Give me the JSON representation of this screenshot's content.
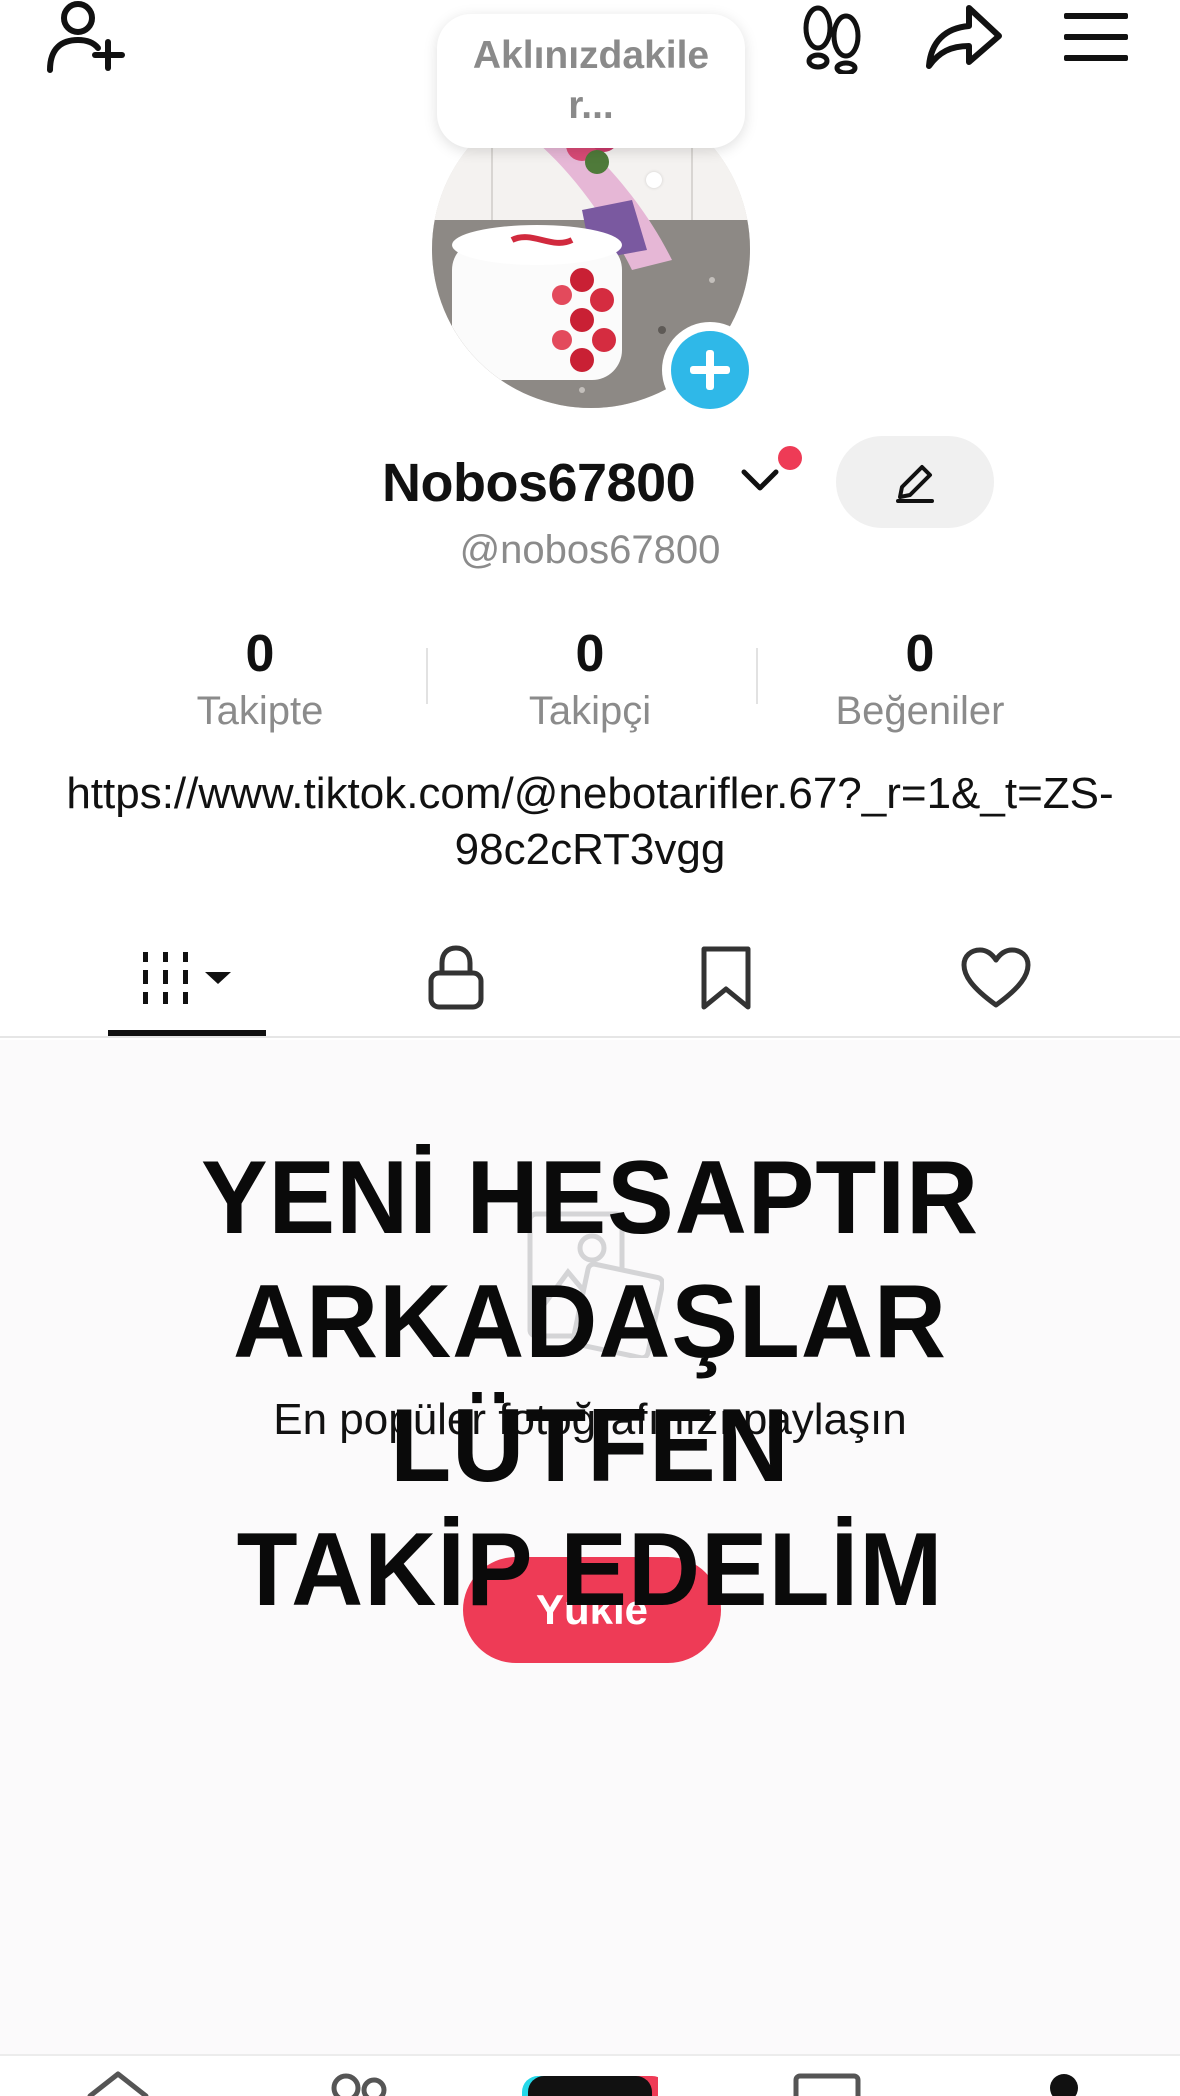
{
  "top_bar": {
    "add_friend_icon": "person-plus-icon",
    "footprint_icon": "footprints-icon",
    "share_icon": "share-arrow-icon",
    "menu_icon": "hamburger-menu-icon"
  },
  "thought_bubble": {
    "text": "Aklınızdakile r..."
  },
  "profile": {
    "display_name": "Nobos67800",
    "handle": "@nobos67800",
    "bio_link": "https://www.tiktok.com/@nebotarifler.67?_r=1&_t=ZS-98c2cRT3vgg"
  },
  "stats": [
    {
      "value": "0",
      "label": "Takipte"
    },
    {
      "value": "0",
      "label": "Takipçi"
    },
    {
      "value": "0",
      "label": "Beğeniler"
    }
  ],
  "tabs": [
    {
      "icon": "grid-filter-icon"
    },
    {
      "icon": "lock-icon"
    },
    {
      "icon": "bookmark-icon"
    },
    {
      "icon": "heart-icon"
    }
  ],
  "empty_state": {
    "text": "En popüler fotoğrafınızı paylaşın",
    "button_label": "Yükle"
  },
  "overlay_text": {
    "line1": "YENİ HESAPTIR",
    "line2": "ARKADAŞLAR LÜTFEN",
    "line3": "TAKİP EDELİM"
  },
  "colors": {
    "accent_red": "#ee3b56",
    "add_blue": "#2fb8e8",
    "muted_gray": "#8b8b8b"
  }
}
